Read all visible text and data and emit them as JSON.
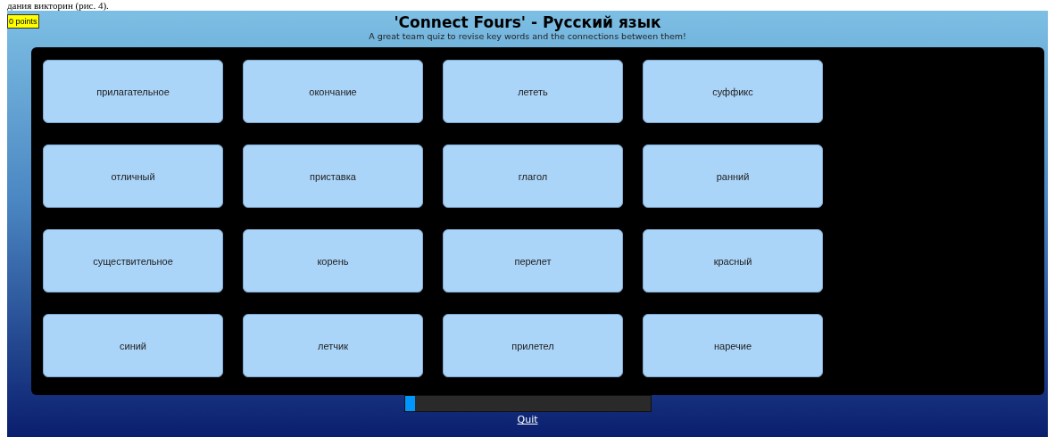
{
  "document_text": "дания викторин (рис. 4).",
  "score": "0 points",
  "title": "'Connect Fours' - Русский язык",
  "subtitle": "A great team quiz to revise key words and the connections between them!",
  "tiles": [
    {
      "label": "прилагательное"
    },
    {
      "label": "окончание"
    },
    {
      "label": "лететь"
    },
    {
      "label": "суффикс"
    },
    {
      "label": "отличный"
    },
    {
      "label": "приставка"
    },
    {
      "label": "глагол"
    },
    {
      "label": "ранний"
    },
    {
      "label": "существительное"
    },
    {
      "label": "корень"
    },
    {
      "label": "перелет"
    },
    {
      "label": "красный"
    },
    {
      "label": "синий"
    },
    {
      "label": "летчик"
    },
    {
      "label": "прилетел"
    },
    {
      "label": "наречие"
    }
  ],
  "timer": {
    "level": 0.04
  },
  "quit_link": "Quit"
}
